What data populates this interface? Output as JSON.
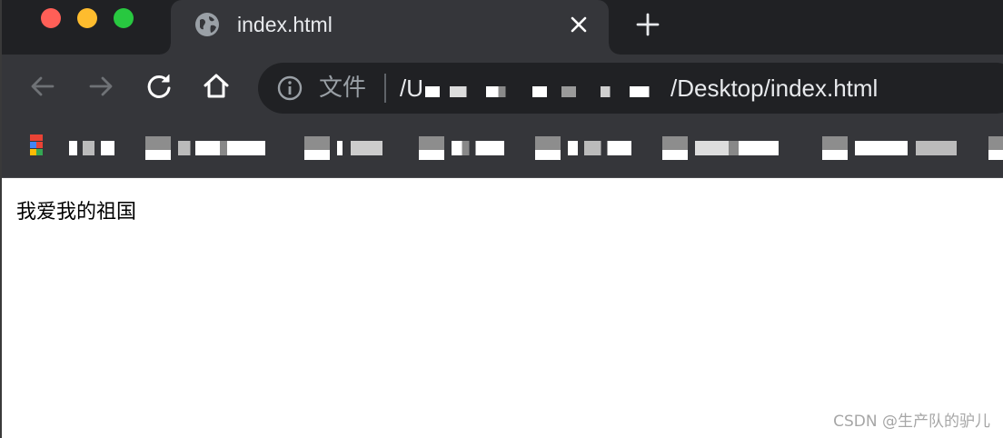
{
  "tab": {
    "title": "index.html",
    "close_icon": "close-icon",
    "favicon": "globe-icon"
  },
  "new_tab_icon": "plus-icon",
  "toolbar": {
    "back_icon": "arrow-left-icon",
    "forward_icon": "arrow-right-icon",
    "reload_icon": "reload-icon",
    "home_icon": "home-icon"
  },
  "omnibox": {
    "info_icon": "info-icon",
    "scheme_label": "文件",
    "url_prefix": "/U",
    "url_suffix": "/Desktop/index.html"
  },
  "page": {
    "text": "我爱我的祖国"
  },
  "watermark": "CSDN @生产队的驴儿",
  "colors": {
    "tabstrip_bg": "#202124",
    "toolbar_bg": "#35363a",
    "omnibox_bg": "#202124",
    "traffic_close": "#ff5f57",
    "traffic_min": "#febc2e",
    "traffic_max": "#28c840"
  }
}
